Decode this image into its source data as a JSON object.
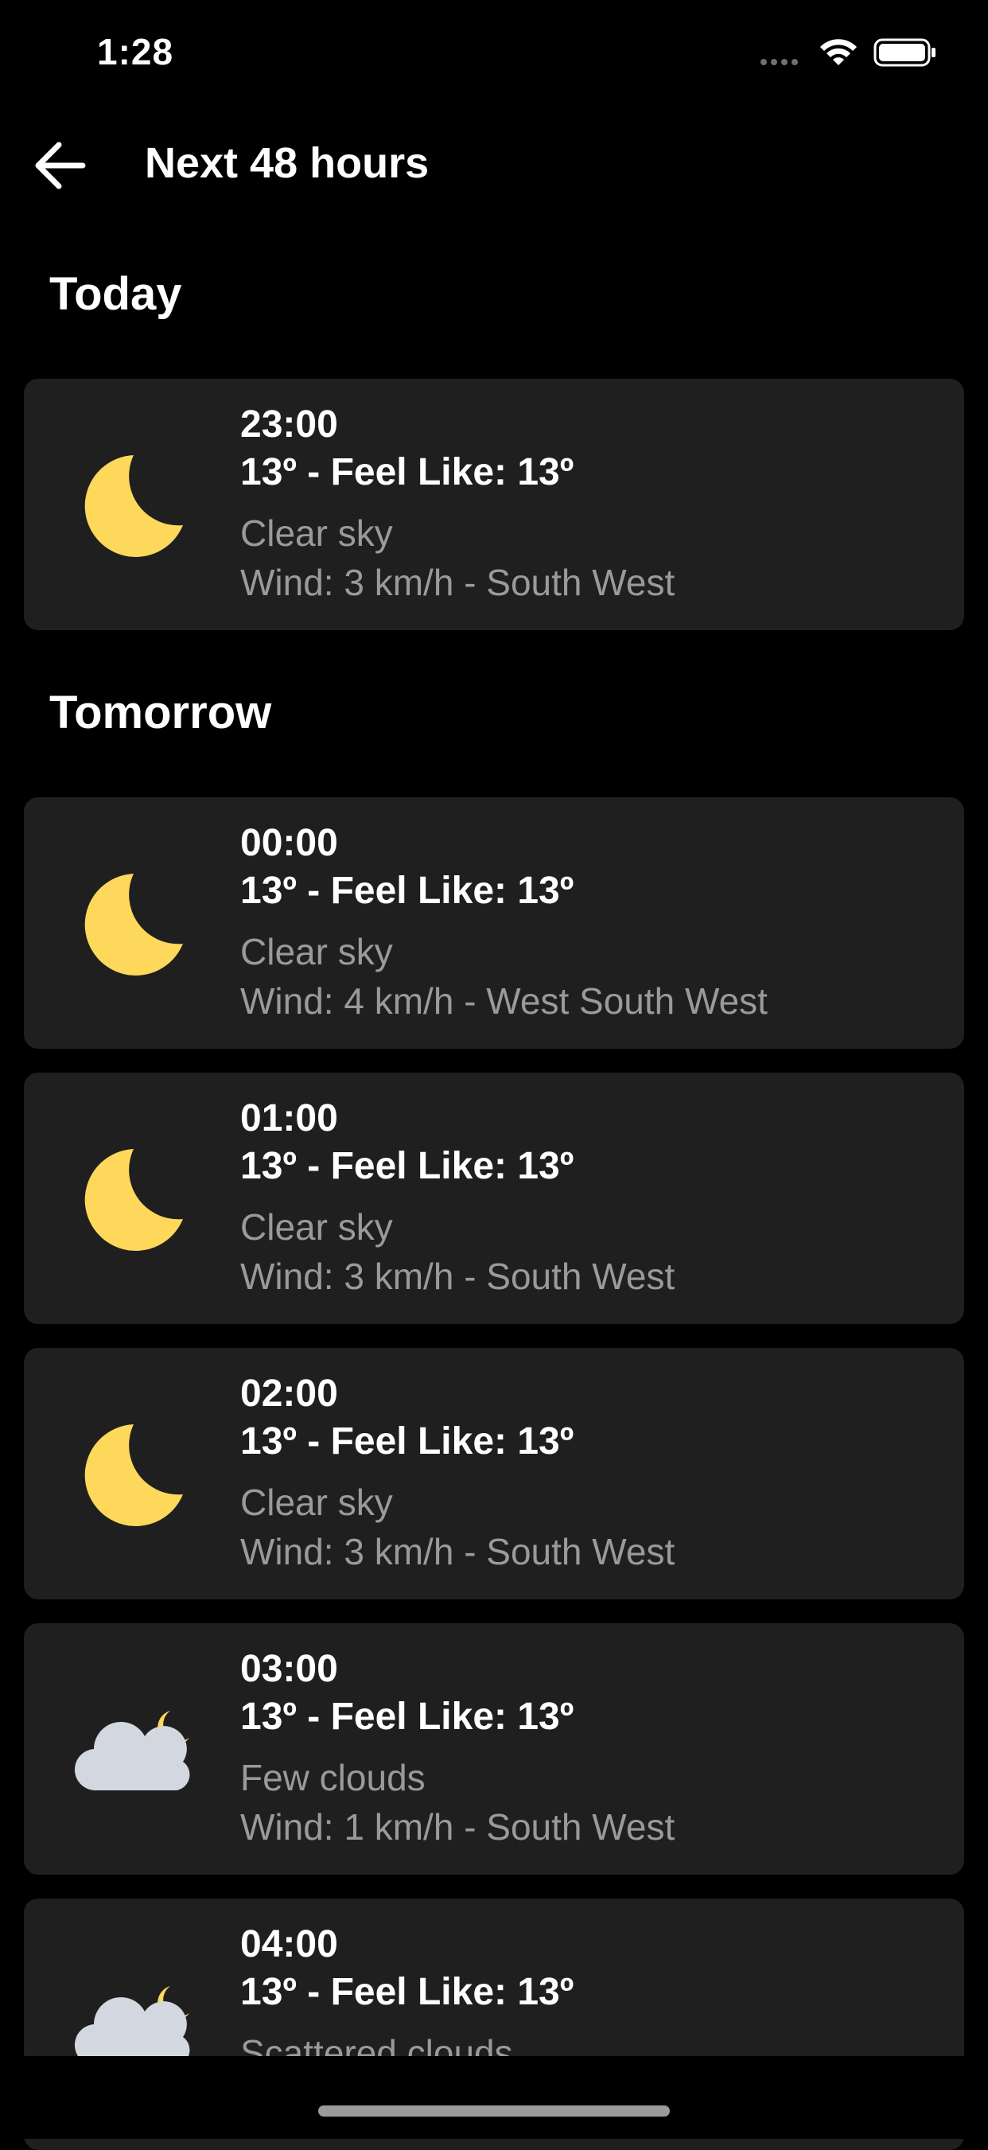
{
  "status_bar": {
    "time": "1:28"
  },
  "header": {
    "title": "Next 48 hours"
  },
  "sections": [
    {
      "title": "Today",
      "items": [
        {
          "time": "23:00",
          "temp": "13º - Feel Like: 13º",
          "desc": "Clear sky",
          "wind": "Wind: 3 km/h - South West",
          "icon": "moon-icon"
        }
      ]
    },
    {
      "title": "Tomorrow",
      "items": [
        {
          "time": "00:00",
          "temp": "13º - Feel Like: 13º",
          "desc": "Clear sky",
          "wind": "Wind: 4 km/h - West South West",
          "icon": "moon-icon"
        },
        {
          "time": "01:00",
          "temp": "13º - Feel Like: 13º",
          "desc": "Clear sky",
          "wind": "Wind: 3 km/h - South West",
          "icon": "moon-icon"
        },
        {
          "time": "02:00",
          "temp": "13º - Feel Like: 13º",
          "desc": "Clear sky",
          "wind": "Wind: 3 km/h - South West",
          "icon": "moon-icon"
        },
        {
          "time": "03:00",
          "temp": "13º - Feel Like: 13º",
          "desc": "Few clouds",
          "wind": "Wind: 1 km/h - South West",
          "icon": "cloud-moon-icon"
        },
        {
          "time": "04:00",
          "temp": "13º - Feel Like: 13º",
          "desc": "Scattered clouds",
          "wind": "",
          "icon": "cloud-moon-icon"
        }
      ]
    }
  ],
  "colors": {
    "background": "#000000",
    "card": "#1f1f1f",
    "moon": "#fdd85a",
    "cloud": "#d3d7e0",
    "secondary_text": "#9a9a9a"
  }
}
